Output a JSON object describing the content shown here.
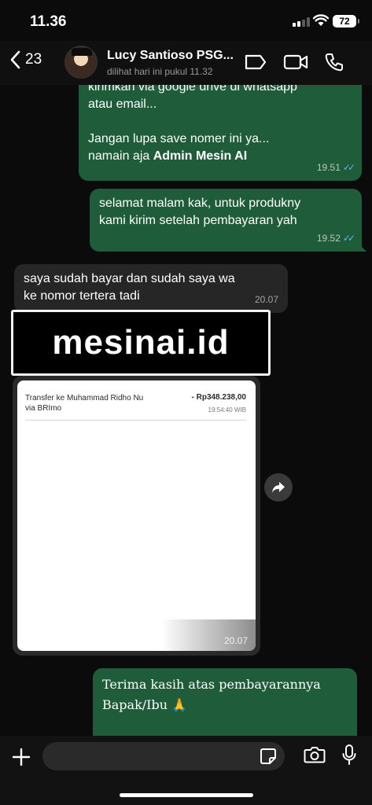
{
  "status_bar": {
    "time": "11.36",
    "battery": "72"
  },
  "header": {
    "back_count": "23",
    "contact_name": "Lucy Santioso PSG...",
    "last_seen": "dilihat hari ini pukul 11.32"
  },
  "messages": [
    {
      "direction": "outgoing",
      "lines": [
        "kirimkan via google drive di whatsapp",
        "atau email...",
        "",
        "Jangan lupa save nomer ini ya...",
        "namain aja "
      ],
      "bold": "Admin Mesin AI",
      "time": "19.51",
      "status": "read"
    },
    {
      "direction": "outgoing",
      "text": "selamat malam kak, untuk produkny\nkami kirim setelah pembayaran yah",
      "time": "19.52",
      "status": "read"
    },
    {
      "direction": "incoming",
      "text": "saya sudah bayar dan sudah saya wa\nke nomor tertera tadi",
      "time": "20.07"
    },
    {
      "direction": "incoming",
      "type": "image",
      "receipt": {
        "title": "Transfer ke Muhammad Ridho Nu via BRImo",
        "amount": "- Rp348.238,00",
        "time": "19:54:40 WIB"
      },
      "time": "20.07"
    },
    {
      "direction": "outgoing",
      "text": "Terima kasih atas pembayarannya\nBapak/Ibu 🙏"
    }
  ],
  "watermark": "mesinai.id",
  "input": {
    "placeholder": "",
    "value": ""
  },
  "colors": {
    "outgoing_bubble": "#1f5c3a",
    "incoming_bubble": "#262626",
    "read_ticks": "#5db4f5"
  },
  "icons": [
    "back-chevron-icon",
    "video-tag-icon",
    "video-call-icon",
    "phone-icon",
    "forward-icon",
    "chevron-down-icon",
    "plus-icon",
    "sticker-icon",
    "camera-icon",
    "microphone-icon"
  ]
}
